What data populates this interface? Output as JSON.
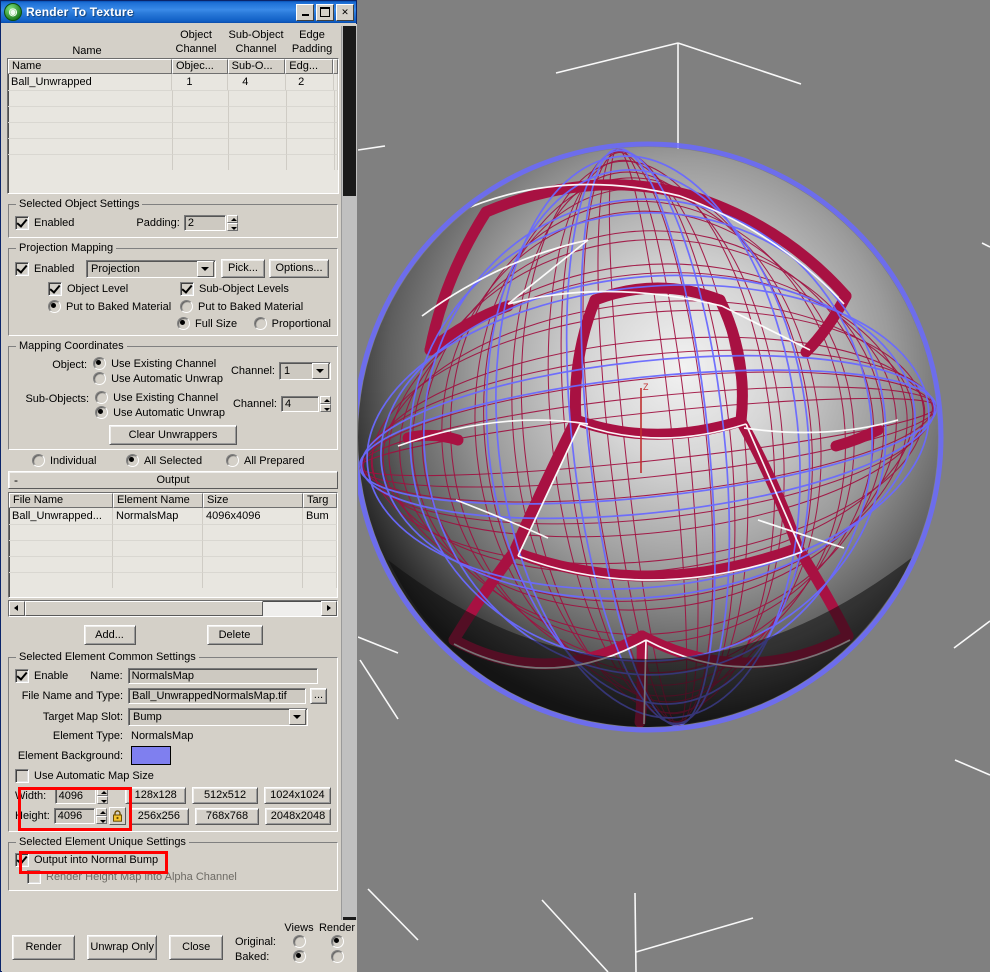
{
  "window": {
    "title": "Render To Texture",
    "icon": "max-logo-icon",
    "minimize_label": "Minimize",
    "maximize_label": "Maximize",
    "close_label": "Close"
  },
  "objects_list": {
    "top_headers": [
      {
        "line1": "",
        "line2": "Name"
      },
      {
        "line1": "Object",
        "line2": "Channel"
      },
      {
        "line1": "Sub-Object",
        "line2": "Channel"
      },
      {
        "line1": "Edge",
        "line2": "Padding"
      }
    ],
    "columns": [
      "Name",
      "Objec...",
      "Sub-O...",
      "Edg...",
      ""
    ],
    "rows": [
      [
        "Ball_Unwrapped",
        "1",
        "4",
        "2",
        ""
      ]
    ]
  },
  "selected_object_settings": {
    "legend": "Selected Object Settings",
    "enabled_label": "Enabled",
    "enabled_checked": true,
    "padding_label": "Padding:",
    "padding_value": "2"
  },
  "projection_mapping": {
    "legend": "Projection Mapping",
    "enabled_label": "Enabled",
    "enabled_checked": true,
    "modifier": "Projection",
    "pick_label": "Pick...",
    "options_label": "Options...",
    "object_level_label": "Object Level",
    "object_level_checked": true,
    "sub_object_levels_label": "Sub-Object Levels",
    "sub_object_levels_checked": true,
    "put_to_baked_left_label": "Put to Baked Material",
    "put_to_baked_left_selected": true,
    "put_to_baked_right_label": "Put to Baked Material",
    "put_to_baked_right_selected": false,
    "full_size_label": "Full Size",
    "full_size_selected": true,
    "proportional_label": "Proportional",
    "proportional_selected": false
  },
  "mapping_coordinates": {
    "legend": "Mapping Coordinates",
    "object_label": "Object:",
    "object_use_existing_label": "Use Existing Channel",
    "object_use_existing_selected": true,
    "object_use_auto_label": "Use Automatic Unwrap",
    "object_use_auto_selected": false,
    "object_channel_label": "Channel:",
    "object_channel_value": "1",
    "sub_objects_label": "Sub-Objects:",
    "sub_use_existing_label": "Use Existing Channel",
    "sub_use_existing_selected": false,
    "sub_use_auto_label": "Use Automatic Unwrap",
    "sub_use_auto_selected": true,
    "sub_channel_label": "Channel:",
    "sub_channel_value": "4",
    "clear_unwrappers_label": "Clear Unwrappers",
    "individual_label": "Individual",
    "individual_selected": false,
    "all_selected_label": "All Selected",
    "all_selected_selected": true,
    "all_prepared_label": "All Prepared",
    "all_prepared_selected": false
  },
  "output": {
    "rollout_title": "Output",
    "rollout_toggle": "-",
    "columns": [
      "File Name",
      "Element Name",
      "Size",
      "Targ"
    ],
    "rows": [
      [
        "Ball_Unwrapped...",
        "NormalsMap",
        "4096x4096",
        "Bum"
      ]
    ],
    "add_label": "Add...",
    "delete_label": "Delete"
  },
  "element_common": {
    "legend": "Selected Element Common Settings",
    "enable_label": "Enable",
    "enable_checked": true,
    "name_label": "Name:",
    "name_value": "NormalsMap",
    "file_name_label": "File Name and Type:",
    "file_name_value": "Ball_UnwrappedNormalsMap.tif",
    "browse_label": "...",
    "target_map_slot_label": "Target Map Slot:",
    "target_map_slot_value": "Bump",
    "element_type_label": "Element Type:",
    "element_type_value": "NormalsMap",
    "element_background_label": "Element Background:",
    "element_background_color": "#7f7fef",
    "use_automatic_map_size_label": "Use Automatic Map Size",
    "use_automatic_map_size_checked": false,
    "width_label": "Width:",
    "width_value": "4096",
    "height_label": "Height:",
    "height_value": "4096",
    "lock_icon": "padlock-icon",
    "size_presets": [
      "128x128",
      "512x512",
      "1024x1024",
      "256x256",
      "768x768",
      "2048x2048"
    ]
  },
  "element_unique": {
    "legend": "Selected Element Unique Settings",
    "output_into_normal_bump_label": "Output into Normal Bump",
    "output_into_normal_bump_checked": true,
    "render_height_map_label": "Render Height Map into Alpha Channel",
    "render_height_map_checked": false
  },
  "footer": {
    "render_label": "Render",
    "unwrap_only_label": "Unwrap Only",
    "close_label": "Close",
    "views_header": "Views",
    "render_header": "Render",
    "original_label": "Original:",
    "original_views_selected": false,
    "original_render_selected": true,
    "baked_label": "Baked:",
    "baked_views_selected": true,
    "baked_render_selected": false
  },
  "viewport": {
    "name": "perspective-viewport",
    "background_color": "#808080",
    "object": "soccer-ball",
    "cage_color": "#6a6aff",
    "wire_color": "#a01040",
    "grid_color": "#ffffff",
    "axis_label": "Z"
  },
  "highlights": [
    {
      "name": "map-size-highlight"
    },
    {
      "name": "normal-bump-highlight"
    }
  ]
}
